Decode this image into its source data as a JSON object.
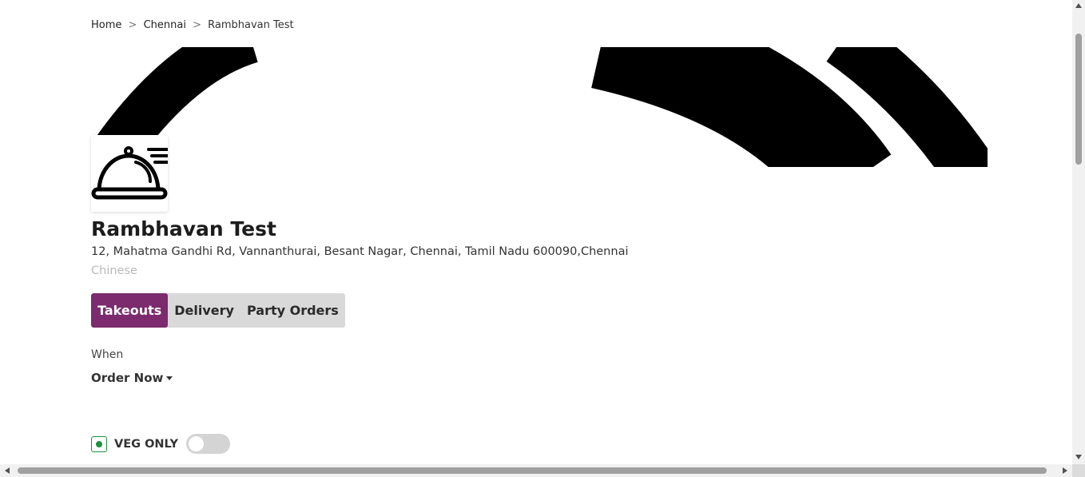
{
  "breadcrumb": {
    "home": "Home",
    "city": "Chennai",
    "current": "Rambhavan Test",
    "separator": ">"
  },
  "restaurant": {
    "name": "Rambhavan Test",
    "address": "12, Mahatma Gandhi Rd, Vannanthurai, Besant Nagar, Chennai, Tamil Nadu 600090,Chennai",
    "cuisine": "Chinese",
    "logo_icon": "food-cloche-icon"
  },
  "order_types": {
    "tabs": [
      {
        "label": "Takeouts",
        "active": true
      },
      {
        "label": "Delivery",
        "active": false
      },
      {
        "label": "Party Orders",
        "active": false
      }
    ],
    "active_color": "#7b2b6e"
  },
  "when": {
    "label": "When",
    "selected": "Order Now"
  },
  "veg_filter": {
    "label": "VEG ONLY",
    "enabled": false,
    "icon": "veg-indicator-icon",
    "color": "#1f8f3b"
  }
}
